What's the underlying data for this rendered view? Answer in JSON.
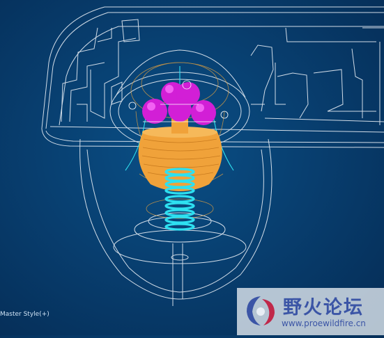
{
  "viewport": {
    "display_style_label": "Master Style(+)",
    "colors": {
      "background": "#083f70",
      "wireframe": "#e8eef5",
      "ball": "#d21fd6",
      "ball_highlight": "#ff7cff",
      "cone": "#f0a23a",
      "spring": "#2ee0f0",
      "sketch_orange": "#e0a040"
    }
  },
  "watermark": {
    "title": "野火论坛",
    "url": "www.proewildfire.cn",
    "logo_icon": "forum-logo-icon"
  }
}
